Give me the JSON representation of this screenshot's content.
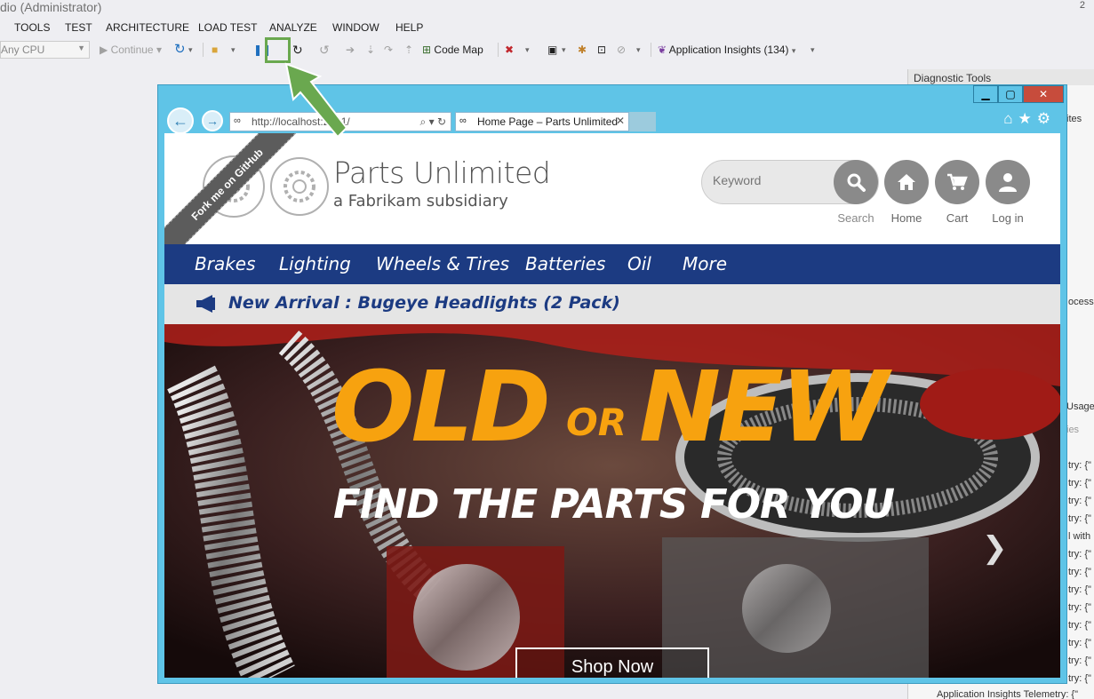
{
  "vs": {
    "title": "dio (Administrator)",
    "title_corner": "2",
    "menu": [
      "TOOLS",
      "TEST",
      "ARCHITECTURE",
      "LOAD TEST",
      "ANALYZE",
      "WINDOW",
      "HELP"
    ],
    "toolbar": {
      "platform": "Any CPU",
      "continue_label": "Continue",
      "code_map_label": "Code Map",
      "app_insights_label": "Application Insights (134)"
    },
    "diagnostic": {
      "header": "Diagnostic Tools",
      "side_texts": [
        "ites",
        "ocess",
        "Usage",
        "ies",
        "try: {\"",
        "try: {\"",
        "try: {\"",
        "try: {\"",
        "l with",
        "try: {\"",
        "try: {\"",
        "try: {\"",
        "try: {\"",
        "try: {\"",
        "try: {\"",
        "try: {\"",
        "try: {\"",
        "try: {\""
      ],
      "bottom_text": "Application Insights Telemetry: {\""
    }
  },
  "browser": {
    "url": "http://localhost:2001/",
    "tab_title": "Home Page – Parts Unlimited"
  },
  "site": {
    "fork_ribbon": "Fork me on GitHub",
    "brand": "Parts Unlimited",
    "tagline": "a Fabrikam subsidiary",
    "search_placeholder": "Keyword",
    "actions": [
      "Search",
      "Home",
      "Cart",
      "Log in"
    ],
    "nav": [
      "Brakes",
      "Lighting",
      "Wheels & Tires",
      "Batteries",
      "Oil",
      "More"
    ],
    "announcement": "New Arrival : Bugeye Headlights (2 Pack)",
    "hero": {
      "old": "OLD",
      "or": "OR",
      "new": "NEW",
      "subtitle": "FIND THE PARTS FOR YOU",
      "cta": "Shop Now"
    }
  },
  "colors": {
    "ie_frame": "#5fc4e7",
    "nav_bg": "#1c3b82",
    "hero_accent": "#f7a20f",
    "highlight": "#6aa84f"
  }
}
